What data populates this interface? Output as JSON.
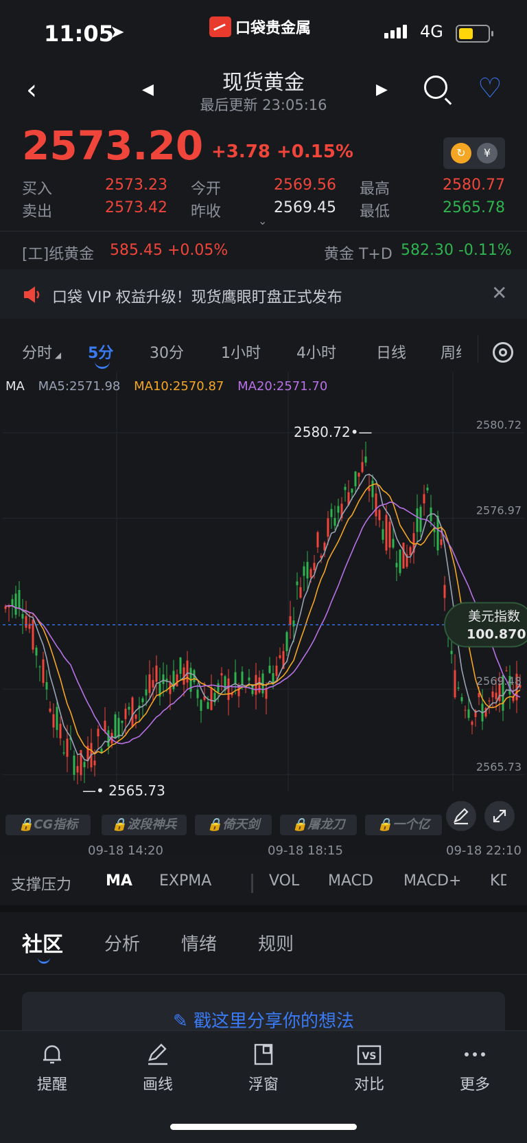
{
  "status_bar": {
    "time": "11:05",
    "network": "4G",
    "brand": "口袋贵金属"
  },
  "header": {
    "title": "现货黄金",
    "updated": "最后更新 23:05:16"
  },
  "quote": {
    "price": "2573.20",
    "change": "+3.78 +0.15%",
    "rows": [
      {
        "l1": "买入",
        "v1": "2573.23",
        "l2": "今开",
        "v2": "2569.56",
        "l3": "最高",
        "v3": "2580.77"
      },
      {
        "l1": "卖出",
        "v1": "2573.42",
        "l2": "昨收",
        "v2": "2569.45",
        "l3": "最低",
        "v3": "2565.78"
      }
    ]
  },
  "tickers": {
    "left_name": "[工]纸黄金",
    "left_value": "585.45 +0.05%",
    "right_name": "黄金 T+D",
    "right_value": "582.30 -0.11%"
  },
  "notice": {
    "text": "口袋 VIP 权益升级！现货鹰眼盯盘正式发布"
  },
  "period_tabs": [
    "分时",
    "5分",
    "30分",
    "1小时",
    "4小时",
    "日线",
    "周线"
  ],
  "active_period": "5分",
  "ma_legend": {
    "label": "MA",
    "ma5": "MA5:2571.98",
    "ma10": "MA10:2570.87",
    "ma20": "MA20:2571.70"
  },
  "chart_data": {
    "type": "candlestick",
    "y_ticks": [
      "2580.72",
      "2576.97",
      "2569.48",
      "2565.73"
    ],
    "ylim": [
      2565.0,
      2581.5
    ],
    "x_ticks": [
      "09-18 14:20",
      "09-18 18:15",
      "09-18 22:10"
    ],
    "max_label": "2580.72",
    "min_label": "2565.73",
    "reference_label": "美元指数",
    "reference_value": "100.870",
    "reference_level": 2572.3
  },
  "locked_indicators": [
    "CG指标",
    "波段神兵",
    "倚天剑",
    "屠龙刀",
    "一个亿"
  ],
  "indicator_tabs": [
    "支撑压力",
    "MA",
    "EXPMA",
    "VOL",
    "MACD",
    "MACD+",
    "KD"
  ],
  "active_indicator": "MA",
  "section_tabs": [
    "社区",
    "分析",
    "情绪",
    "规则"
  ],
  "active_section": "社区",
  "share_prompt": "戳这里分享你的想法",
  "bottom_nav": [
    {
      "label": "提醒",
      "icon": "bell-icon"
    },
    {
      "label": "画线",
      "icon": "pen-icon"
    },
    {
      "label": "浮窗",
      "icon": "float-window-icon"
    },
    {
      "label": "对比",
      "icon": "vs-icon"
    },
    {
      "label": "更多",
      "icon": "more-icon"
    }
  ],
  "colors": {
    "up": "#f0453a",
    "down": "#2fb34f",
    "accent": "#3a7bf4",
    "ma5": "#9aa3b5",
    "ma10": "#f5a623",
    "ma20": "#b872e6"
  }
}
